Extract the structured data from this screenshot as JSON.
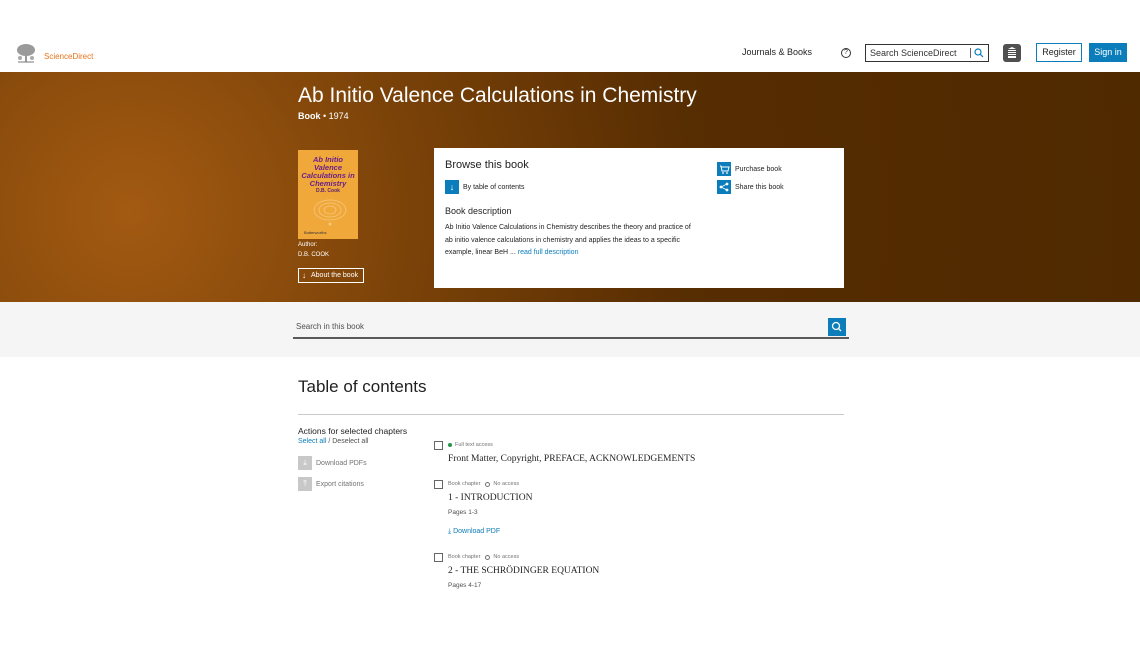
{
  "header": {
    "logo_text": "ScienceDirect",
    "journals_books": "Journals & Books",
    "help_icon": "?",
    "search_placeholder": "Search ScienceDirect",
    "register": "Register",
    "sign_in": "Sign in"
  },
  "book": {
    "title": "Ab Initio Valence Calculations in Chemistry",
    "type": "Book",
    "year": "• 1974",
    "cover_title": "Ab Initio Valence Calculations in Chemistry",
    "cover_author": "D.B. Cook",
    "cover_publisher": "Butterworths",
    "author_label": "Author:",
    "author_name": "D.B. COOK",
    "about_button": "About the book"
  },
  "browse": {
    "title": "Browse this book",
    "by_toc": "By table of contents",
    "desc_title": "Book description",
    "desc_text": "Ab Initio Valence Calculations in Chemistry describes the theory and practice of ab initio valence calculations in chemistry and applies the ideas to a specific example, linear BeH ...",
    "read_full": "read full description",
    "purchase": "Purchase book",
    "share": "Share this book"
  },
  "book_search": {
    "placeholder": "Search in this book"
  },
  "toc": {
    "heading": "Table of contents",
    "actions_title": "Actions for selected chapters",
    "select_all": "Select all",
    "separator": " / ",
    "deselect_all": "Deselect all",
    "download_pdfs": "Download PDFs",
    "export_citations": "Export citations",
    "chapters": [
      {
        "meta": "Full text access",
        "title": "Front Matter, Copyright, PREFACE, ACKNOWLEDGEMENTS"
      },
      {
        "meta_type": "Book chapter",
        "meta_access": "No access",
        "title": "1 - INTRODUCTION",
        "pages": "Pages 1-3",
        "download": "Download PDF"
      },
      {
        "meta_type": "Book chapter",
        "meta_access": "No access",
        "title": "2 - THE SCHRÖDINGER EQUATION",
        "pages": "Pages 4-17"
      }
    ]
  },
  "colors": {
    "accent": "#0c7dbb",
    "brand_orange": "#e9711c",
    "hero_brown": "#572d02"
  }
}
